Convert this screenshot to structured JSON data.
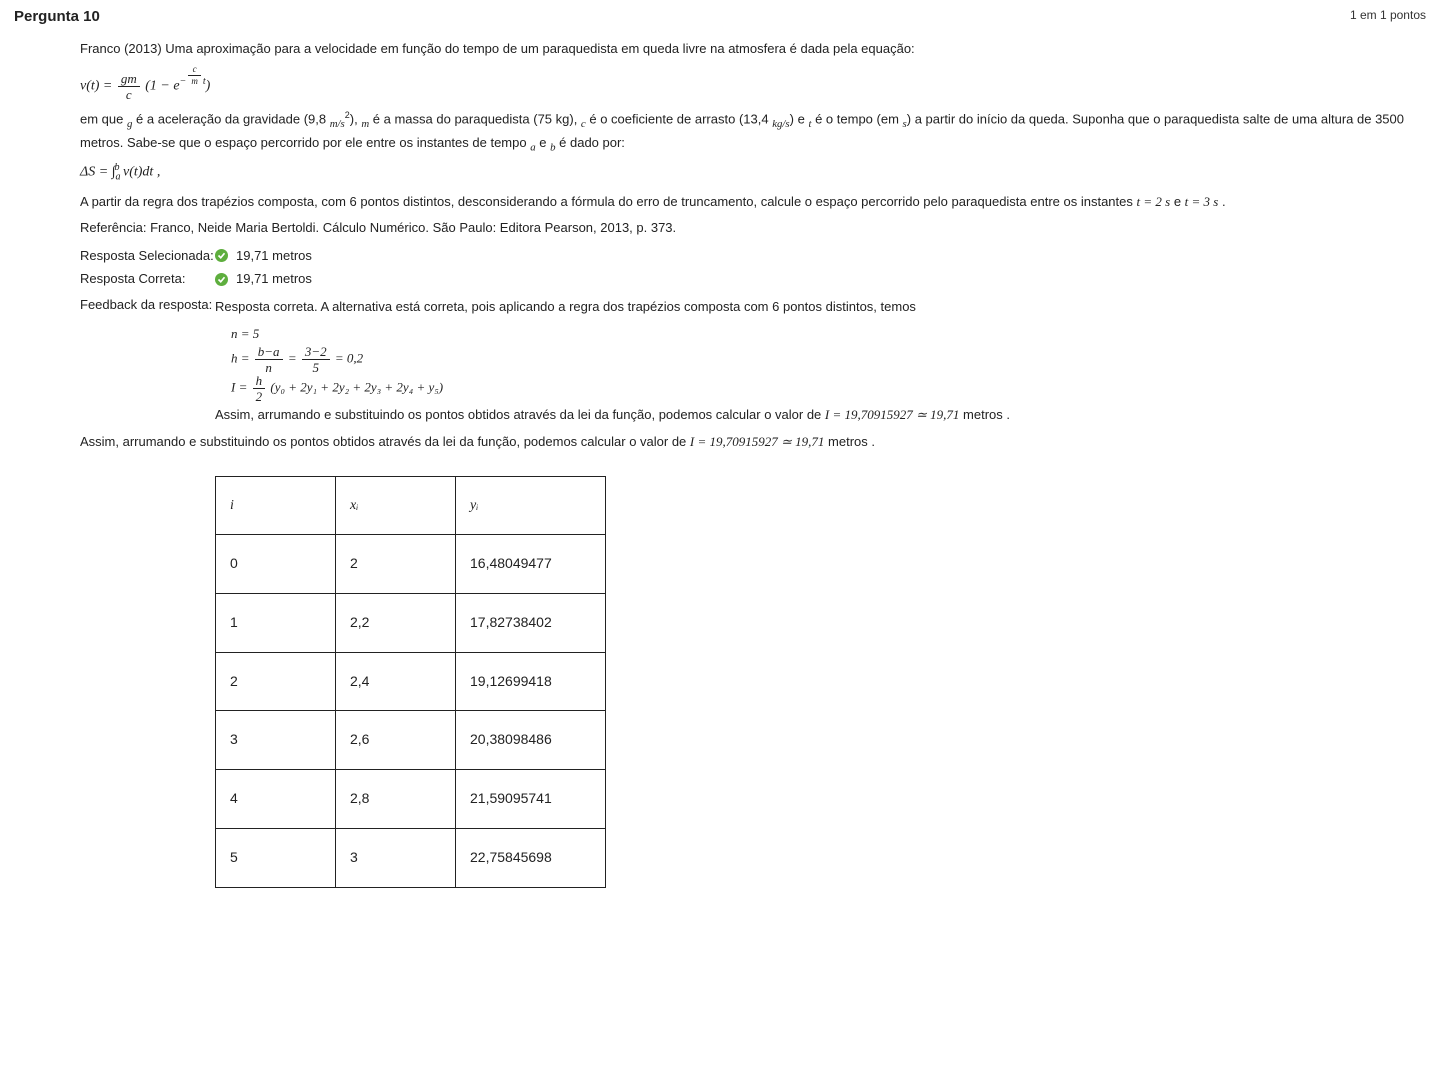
{
  "header": {
    "question_label": "Pergunta 10",
    "points_label": "1 em 1 pontos"
  },
  "problem": {
    "intro": "Franco  (2013) Uma aproximação para a velocidade em função do tempo de um paraquedista em queda livre na atmosfera é dada pela equação:",
    "eq1_lhs": "v(t) =",
    "eq1_frac_num": "gm",
    "eq1_frac_den": "c",
    "eq1_rhs_a": "(1 − e",
    "eq1_exp_frac_num": "c",
    "eq1_exp_frac_den": "m",
    "eq1_exp_tail": "t",
    "eq1_rhs_b": ")",
    "desc1_a": "em que ",
    "desc1_g": "g",
    "desc1_b": " é a aceleração da gravidade (9,8 ",
    "desc1_ms2": "m/s",
    "desc1_sq": "2",
    "desc1_c": "), ",
    "desc1_m": "m",
    "desc1_d": " é a massa do paraquedista (75 kg), ",
    "desc1_cvar": "c",
    "desc1_e": " é o coeficiente de arrasto (13,4 ",
    "desc1_kgs": "kg/s",
    "desc1_f": ") e ",
    "desc1_t": "t",
    "desc1_g2": " é o tempo (em ",
    "desc1_s": "s",
    "desc1_h": ") a partir do início da queda. Suponha que o paraquedista salte de uma altura de 3500 metros. Sabe-se que o espaço percorrido por ele entre os instantes de tempo ",
    "desc1_a2": "a",
    "desc1_i": " e ",
    "desc1_b2": "b",
    "desc1_j": " é dado por:",
    "eq2": "ΔS = ∫",
    "eq2_sub": "a",
    "eq2_sup": "b",
    "eq2_tail": "   v(t)dt ,",
    "task_a": "A partir da regra dos trapézios composta, com 6 pontos distintos, desconsiderando a fórmula do erro de truncamento, calcule o espaço percorrido pelo paraquedista entre os instantes ",
    "task_t1": "t = 2 s",
    "task_mid": " e ",
    "task_t2": "t = 3 s",
    "task_end": " .",
    "reference": "Referência: Franco, Neide Maria Bertoldi. Cálculo Numérico. São Paulo: Editora Pearson, 2013, p. 373."
  },
  "answers": {
    "selected_label": "Resposta Selecionada:",
    "selected_value": "19,71 metros",
    "correct_label": "Resposta Correta:",
    "correct_value": "19,71 metros"
  },
  "feedback": {
    "label": "Feedback da resposta:",
    "intro": "Resposta correta. A alternativa está correta, pois aplicando a regra dos trapézios composta com 6 pontos distintos, temos",
    "l1": "n = 5",
    "l2_pre": "h = ",
    "l2_f1n": "b−a",
    "l2_f1d": "n",
    "l2_mid": " = ",
    "l2_f2n": "3−2",
    "l2_f2d": "5",
    "l2_end": " = 0,2",
    "l3_pre": "I = ",
    "l3_fracn": "h",
    "l3_fracd": "2",
    "l3_rest": "(y₀ + 2y₁ + 2y₂ + 2y₃ + 2y₄ + y₅)",
    "concl_a": "Assim, arrumando e substituindo os pontos obtidos através da lei da função, podemos calcular o valor de ",
    "concl_I": "I = 19,70915927 ≃ 19,71",
    "concl_b": " metros .",
    "concl2_a": "Assim, arrumando e substituindo os pontos obtidos através da lei da função, podemos calcular o valor de ",
    "concl2_I": "I = 19,70915927 ≃ 19,71",
    "concl2_b": " metros ."
  },
  "table": {
    "headers": {
      "i": "i",
      "x": "xᵢ",
      "y": "yᵢ"
    },
    "rows": [
      {
        "i": "0",
        "x": "2",
        "y": "16,48049477"
      },
      {
        "i": "1",
        "x": "2,2",
        "y": "17,82738402"
      },
      {
        "i": "2",
        "x": "2,4",
        "y": "19,12699418"
      },
      {
        "i": "3",
        "x": "2,6",
        "y": "20,38098486"
      },
      {
        "i": "4",
        "x": "2,8",
        "y": "21,59095741"
      },
      {
        "i": "5",
        "x": "3",
        "y": "22,75845698"
      }
    ]
  }
}
